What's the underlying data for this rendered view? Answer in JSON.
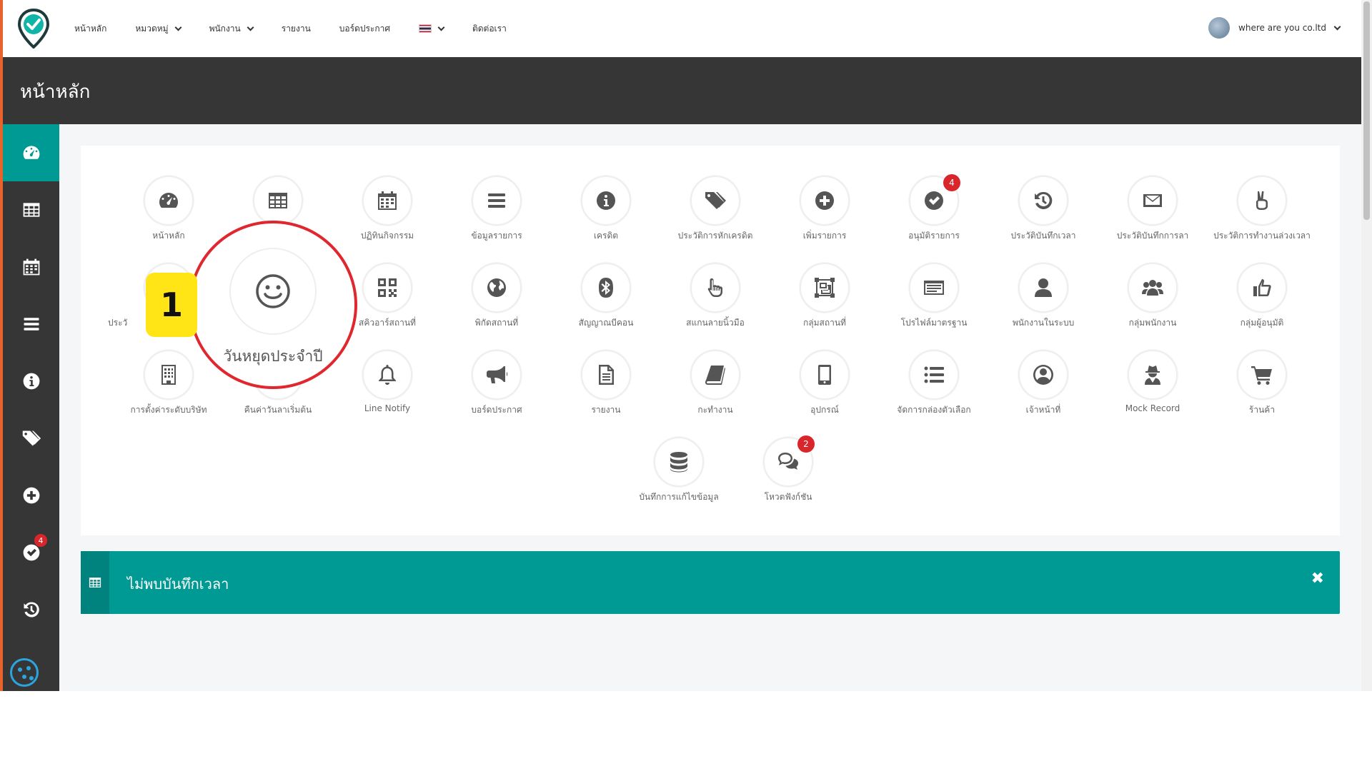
{
  "nav": {
    "items": [
      {
        "label": "หน้าหลัก",
        "dropdown": false
      },
      {
        "label": "หมวดหมู่",
        "dropdown": true
      },
      {
        "label": "พนักงาน",
        "dropdown": true
      },
      {
        "label": "รายงาน",
        "dropdown": false
      },
      {
        "label": "บอร์ดประกาศ",
        "dropdown": false
      }
    ],
    "contact": "ติดต่อเรา",
    "user_name": "where are you co.ltd"
  },
  "page": {
    "title": "หน้าหลัก"
  },
  "sidebar": {
    "items": [
      {
        "icon": "dashboard-icon",
        "active": true
      },
      {
        "icon": "table-icon"
      },
      {
        "icon": "calendar-icon"
      },
      {
        "icon": "list-icon"
      },
      {
        "icon": "info-icon"
      },
      {
        "icon": "tags-icon"
      },
      {
        "icon": "plus-circle-icon"
      },
      {
        "icon": "check-circle-icon",
        "badge": "4"
      },
      {
        "icon": "history-icon"
      }
    ]
  },
  "tiles": [
    {
      "label": "หน้าหลัก",
      "icon": "dashboard-icon"
    },
    {
      "label": "",
      "icon": "table-icon"
    },
    {
      "label": "ปฏิทินกิจกรรม",
      "icon": "calendar-icon"
    },
    {
      "label": "ข้อมูลรายการ",
      "icon": "list-icon"
    },
    {
      "label": "เครดิต",
      "icon": "info-icon"
    },
    {
      "label": "ประวัติการหักเครดิต",
      "icon": "tags-icon"
    },
    {
      "label": "เพิ่มรายการ",
      "icon": "plus-circle-icon"
    },
    {
      "label": "อนุมัติรายการ",
      "icon": "check-circle-icon",
      "badge": "4"
    },
    {
      "label": "ประวัติบันทึกเวลา",
      "icon": "history-icon"
    },
    {
      "label": "ประวัติบันทึกการลา",
      "icon": "envelope-icon"
    },
    {
      "label": "ประวัติการทำงานล่วงเวลา",
      "icon": "peace-hand-icon"
    },
    {
      "label": "ประวั",
      "icon": "hidden-icon"
    },
    {
      "label": "",
      "icon": "smile-icon"
    },
    {
      "label": "สคิวอาร์สถานที่",
      "icon": "qrcode-icon"
    },
    {
      "label": "พิกัดสถานที่",
      "icon": "globe-icon"
    },
    {
      "label": "สัญญาณบีคอน",
      "icon": "bluetooth-icon"
    },
    {
      "label": "สแกนลายนิ้วมือ",
      "icon": "hand-pointer-icon"
    },
    {
      "label": "กลุ่มสถานที่",
      "icon": "object-group-icon"
    },
    {
      "label": "โปรไฟล์มาตรฐาน",
      "icon": "id-card-icon"
    },
    {
      "label": "พนักงานในระบบ",
      "icon": "user-icon"
    },
    {
      "label": "กลุ่มพนักงาน",
      "icon": "users-icon"
    },
    {
      "label": "กลุ่มผู้อนุมัติ",
      "icon": "thumbs-up-icon"
    },
    {
      "label": "การตั้งค่าระดับบริษัท",
      "icon": "building-icon"
    },
    {
      "label": "คืนค่าวันลาเริ่มต้น",
      "icon": "reset-icon"
    },
    {
      "label": "Line Notify",
      "icon": "bell-icon"
    },
    {
      "label": "บอร์ดประกาศ",
      "icon": "bullhorn-icon"
    },
    {
      "label": "รายงาน",
      "icon": "file-icon"
    },
    {
      "label": "กะทำงาน",
      "icon": "book-icon"
    },
    {
      "label": "อุปกรณ์",
      "icon": "mobile-icon"
    },
    {
      "label": "จัดการกล่องตัวเลือก",
      "icon": "list-ul-icon"
    },
    {
      "label": "เจ้าหน้าที่",
      "icon": "user-circle-icon"
    },
    {
      "label": "Mock Record",
      "icon": "user-secret-icon"
    },
    {
      "label": "ร้านค้า",
      "icon": "cart-icon"
    },
    {
      "label": "บันทึกการแก้ไขข้อมูล",
      "icon": "database-icon"
    },
    {
      "label": "โหวตฟังก์ชัน",
      "icon": "comments-icon",
      "badge": "2"
    }
  ],
  "alert": {
    "text": "ไม่พบบันทึกเวลา",
    "close": "✖"
  },
  "tutorial": {
    "step": "1",
    "label": "วันหยุดประจำปี"
  }
}
